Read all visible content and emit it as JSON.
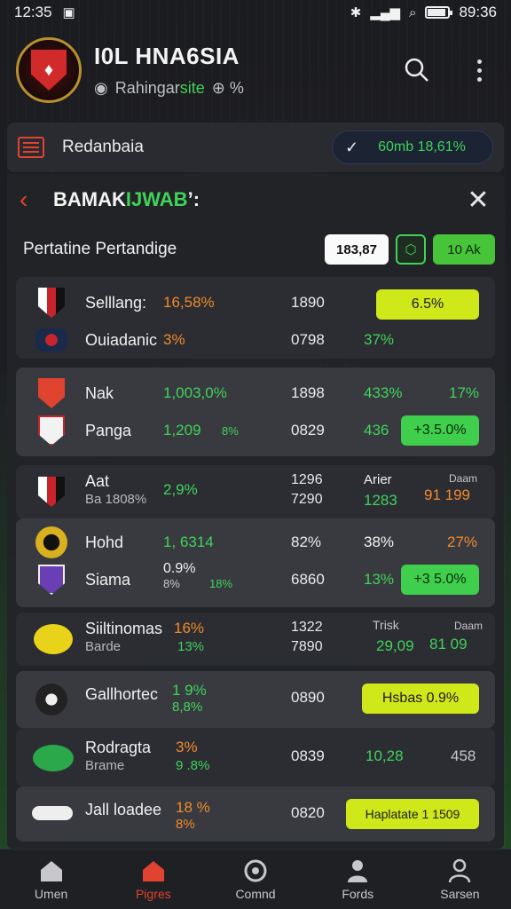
{
  "status_bar": {
    "time": "12:35",
    "clock_right": "89:36"
  },
  "header": {
    "title": "I0L HNA6SIA",
    "subtitle_main": "Rahingar",
    "subtitle_accent": "site",
    "subtitle_extra": "⊕ %"
  },
  "section": {
    "label": "Redanbaia",
    "balance": "60mb 18,61%"
  },
  "panel": {
    "title_main": "BAMAK",
    "title_accent": "IJWAB",
    "title_tail": "’:",
    "filter_title": "Pertatine Pertandige",
    "filter_value": "183,87",
    "filter_green": "10 Ak"
  },
  "matches": [
    {
      "home": {
        "name": "Selllang:",
        "pct": "16,58%",
        "mid": "1890",
        "r1": "",
        "r2": ""
      },
      "away": {
        "name": "Ouiadanic",
        "pct": "3%",
        "mid": "0798",
        "r1": "37%",
        "r2": ""
      },
      "button": "6.5%"
    },
    {
      "home": {
        "name": "Nak",
        "pct": "1,003,0%",
        "mid": "1898",
        "r1": "433%",
        "r2": "17%"
      },
      "away": {
        "name": "Panga",
        "pct": "1,209",
        "pct_small": "8%",
        "mid": "0829",
        "r1": "436",
        "r2": ""
      },
      "button": "+3.5.0%"
    },
    {
      "home": {
        "name": "Aat",
        "sub": "Ba 1808%",
        "pct": "2,9%",
        "mid": "1296",
        "mid2": "7290",
        "r1_top": "Arier",
        "r1": "1283",
        "r2_top": "Daam",
        "r2": "91 199"
      }
    },
    {
      "home": {
        "name": "Hohd",
        "pct": "1, 6314",
        "mid": "82%",
        "r1": "38%",
        "r2": "27%"
      },
      "away": {
        "name": "Siama",
        "pct": "0.9%",
        "pct_sub": "8%",
        "pct_small": "18%",
        "mid": "6860",
        "r1": "13%",
        "r2": ""
      },
      "button": "+3 5.0%"
    },
    {
      "home": {
        "name": "Siiltinomas",
        "sub": "Barde",
        "pct": "16%",
        "pct_sub": "13%",
        "mid": "1322",
        "mid2": "7890",
        "r1_top": "Trisk",
        "r1": "29,09",
        "r2_top": "Daam",
        "r2": "81 09"
      }
    },
    {
      "home": {
        "name": "Gallhortec",
        "pct": "1 9%",
        "pct_sub": "8,8%",
        "mid": "0890"
      },
      "button": "Hsbas 0.9%"
    },
    {
      "home": {
        "name": "Rodragta",
        "sub": "Brame",
        "pct": "3%",
        "pct_sub": "9 .8%",
        "mid": "0839",
        "r1": "10,28",
        "r2": "458"
      }
    },
    {
      "home": {
        "name": "Jall loadee",
        "pct": "18 %",
        "pct_sub": "8%",
        "mid": "0820"
      },
      "button": "Haplatate 1 1509"
    }
  ],
  "nav": [
    {
      "label": "Umen",
      "icon": "home-icon"
    },
    {
      "label": "Pigres",
      "icon": "home-icon",
      "active": true
    },
    {
      "label": "Comnd",
      "icon": "circle-icon"
    },
    {
      "label": "Fords",
      "icon": "person-icon"
    },
    {
      "label": "Sarsen",
      "icon": "user-outline-icon"
    }
  ],
  "colors": {
    "accent_red": "#e0432f",
    "accent_green": "#3fd35a",
    "lime": "#cfe81a",
    "orange": "#f08a2a"
  }
}
